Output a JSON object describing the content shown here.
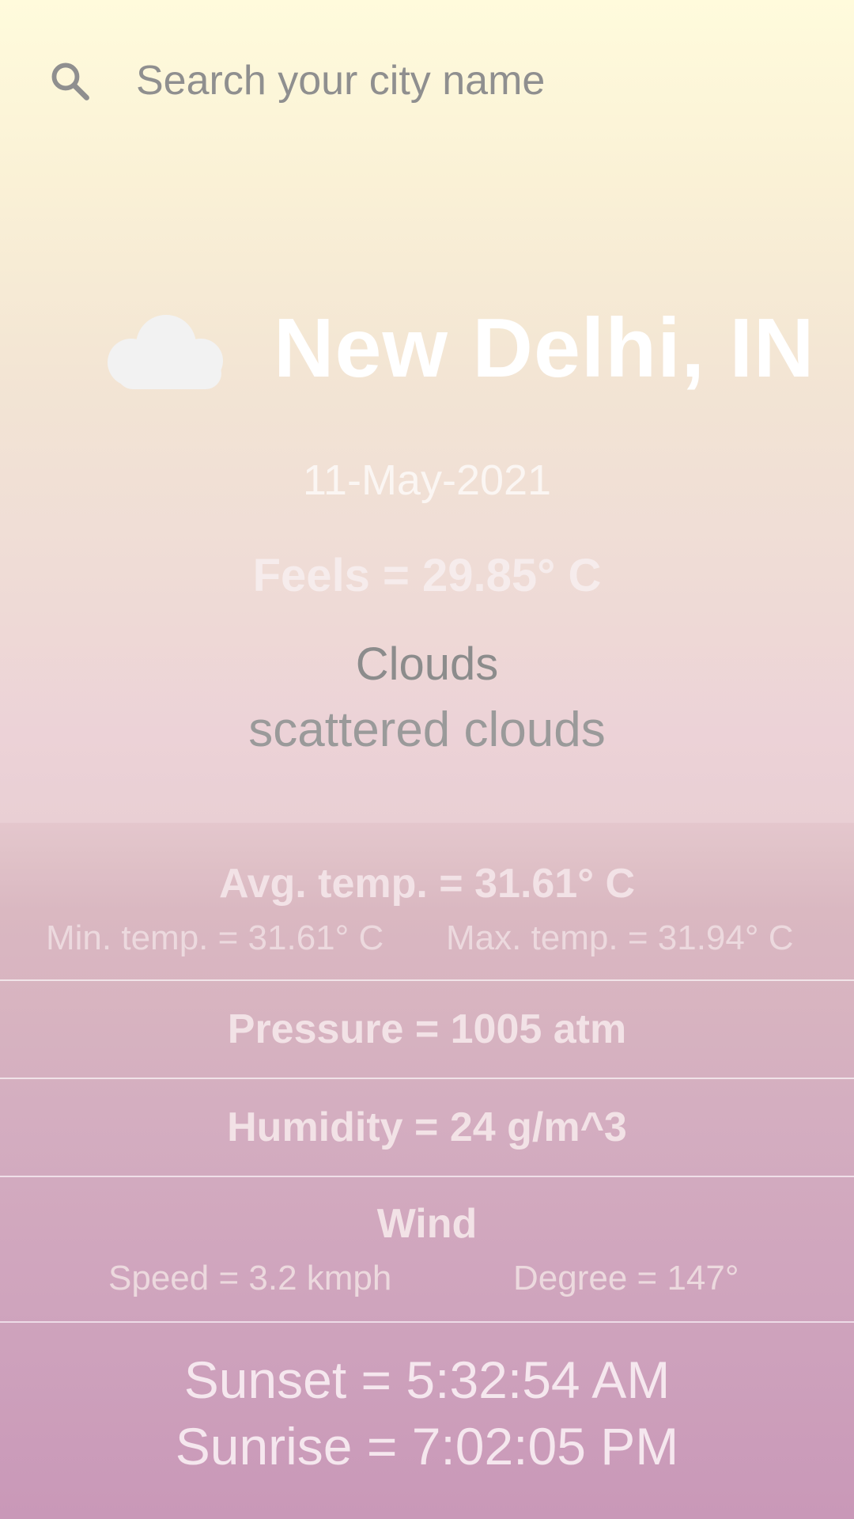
{
  "search": {
    "placeholder": "Search your city name",
    "icon": "search-icon"
  },
  "weather": {
    "icon": "cloud-icon",
    "city": "New Delhi, IN",
    "date": "11-May-2021",
    "feels": "Feels = 29.85° C",
    "condition": "Clouds",
    "description": "scattered clouds"
  },
  "stats": {
    "avg_temp": "Avg. temp. = 31.61° C",
    "min_temp": "Min. temp. = 31.61° C",
    "max_temp": "Max. temp. = 31.94° C",
    "pressure": "Pressure = 1005 atm",
    "humidity": "Humidity = 24 g/m^3",
    "wind_title": "Wind",
    "wind_speed": "Speed = 3.2 kmph",
    "wind_degree": "Degree = 147°",
    "sunset": "Sunset = 5:32:54 AM",
    "sunrise": "Sunrise = 7:02:05 PM"
  },
  "colors": {
    "background_top": "#fffbdc",
    "background_bottom": "#cd9dbe",
    "city_text": "#ffffff",
    "muted_text": "#8f8f8f"
  }
}
